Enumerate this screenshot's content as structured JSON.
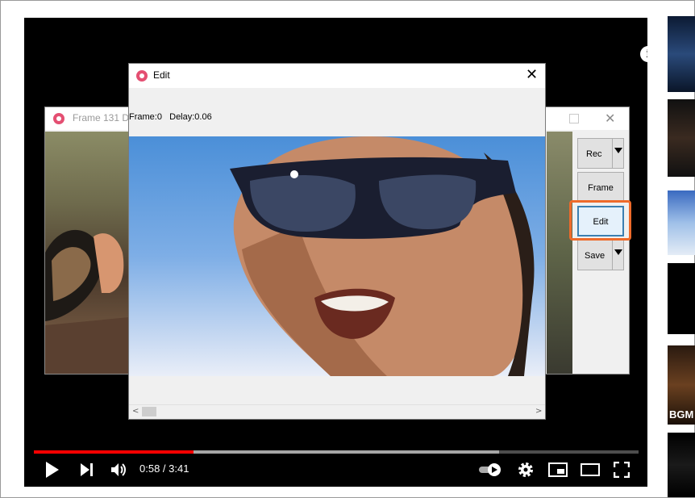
{
  "recorder": {
    "title": "Frame 131 D",
    "buttons": {
      "rec": "Rec",
      "frame": "Frame",
      "edit": "Edit",
      "save": "Save"
    }
  },
  "edit_dialog": {
    "title": "Edit",
    "frame_info": "Frame:0   Delay:0.06",
    "scroll_left": "<",
    "scroll_right": ">"
  },
  "player": {
    "time": "0:58 / 3:41",
    "progress_played": 0.264,
    "progress_buffered": 0.769
  },
  "thumbnails": {
    "label": "BGM"
  },
  "colors": {
    "accent": "#ff0000",
    "highlight": "#ef6a2a",
    "app_icon": "#e44f72"
  }
}
